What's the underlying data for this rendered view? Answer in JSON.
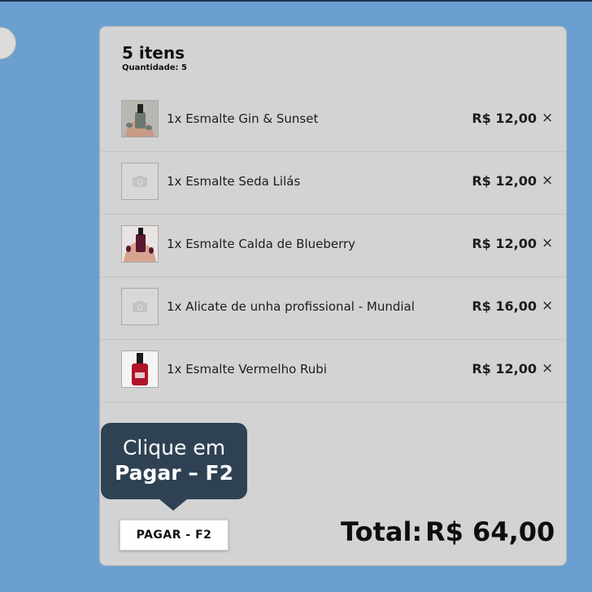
{
  "cart": {
    "title": "5 itens",
    "quantity_text": "Quantidade: 5",
    "items": [
      {
        "name": "1x Esmalte Gin & Sunset",
        "price": "R$ 12,00",
        "remove_icon": "×",
        "thumb": "photo-hand-gray-polish"
      },
      {
        "name": "1x Esmalte Seda Lilás",
        "price": "R$ 12,00",
        "remove_icon": "×",
        "thumb": "camera-placeholder"
      },
      {
        "name": "1x Esmalte Calda de Blueberry",
        "price": "R$ 12,00",
        "remove_icon": "×",
        "thumb": "photo-hand-wine-polish"
      },
      {
        "name": "1x Alicate de unha profissional - Mundial",
        "price": "R$ 16,00",
        "remove_icon": "×",
        "thumb": "camera-placeholder"
      },
      {
        "name": "1x Esmalte Vermelho Rubi",
        "price": "R$ 12,00",
        "remove_icon": "×",
        "thumb": "photo-red-polish-bottle"
      }
    ]
  },
  "tooltip": {
    "line1": "Clique em",
    "line2": "Pagar – F2"
  },
  "checkout": {
    "pay_label": "PAGAR - F2",
    "total_label": "Total:",
    "total_value": "R$ 64,00"
  },
  "colors": {
    "background": "#6a9fcf",
    "panel": "#d3d3d3",
    "tooltip": "#2f4254"
  }
}
